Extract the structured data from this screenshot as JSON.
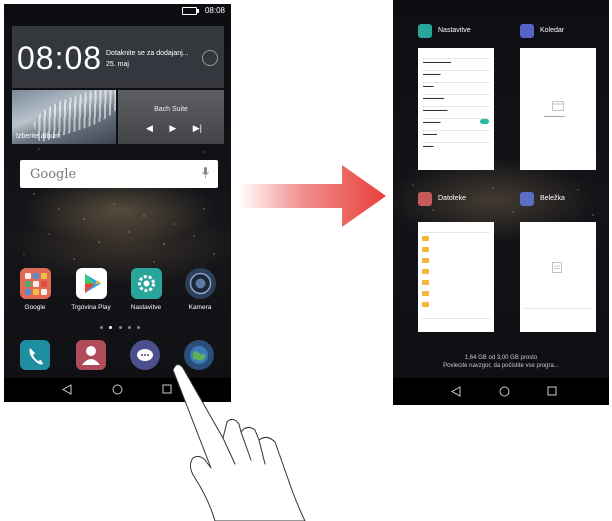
{
  "left_phone": {
    "status_time": "08:08",
    "clock_time": "08:08",
    "event_line1": "Dotaknite se za dodajanj...",
    "event_line2": "25. maj",
    "photo_caption": "Izberite album",
    "music_title": "Bach Suite",
    "search_placeholder": "Google",
    "apps": [
      {
        "label": "Google",
        "icon": "google-folder-icon"
      },
      {
        "label": "Trgovina Play",
        "icon": "play-store-icon"
      },
      {
        "label": "Nastavitve",
        "icon": "settings-icon"
      },
      {
        "label": "Kamera",
        "icon": "camera-icon"
      }
    ],
    "dock": [
      "phone-icon",
      "contacts-icon",
      "messages-icon",
      "browser-icon"
    ]
  },
  "right_phone": {
    "cards": [
      {
        "title": "Nastavitve",
        "icon": "settings-icon",
        "color": "#2aa59a"
      },
      {
        "title": "Koledar",
        "icon": "calendar-icon",
        "color": "#5562c9"
      },
      {
        "title": "Datoteke",
        "icon": "files-icon",
        "color": "#c65a5a"
      },
      {
        "title": "Beležka",
        "icon": "notepad-icon",
        "color": "#5a6ec6"
      }
    ],
    "storage_line1": "1,64 GB od 3,00 GB prosto",
    "storage_line2": "Povlecite navzgor, da počistite vse progra..."
  },
  "colors": {
    "arrow_red": "#e8403c",
    "accent_teal": "#2bb6a4"
  }
}
